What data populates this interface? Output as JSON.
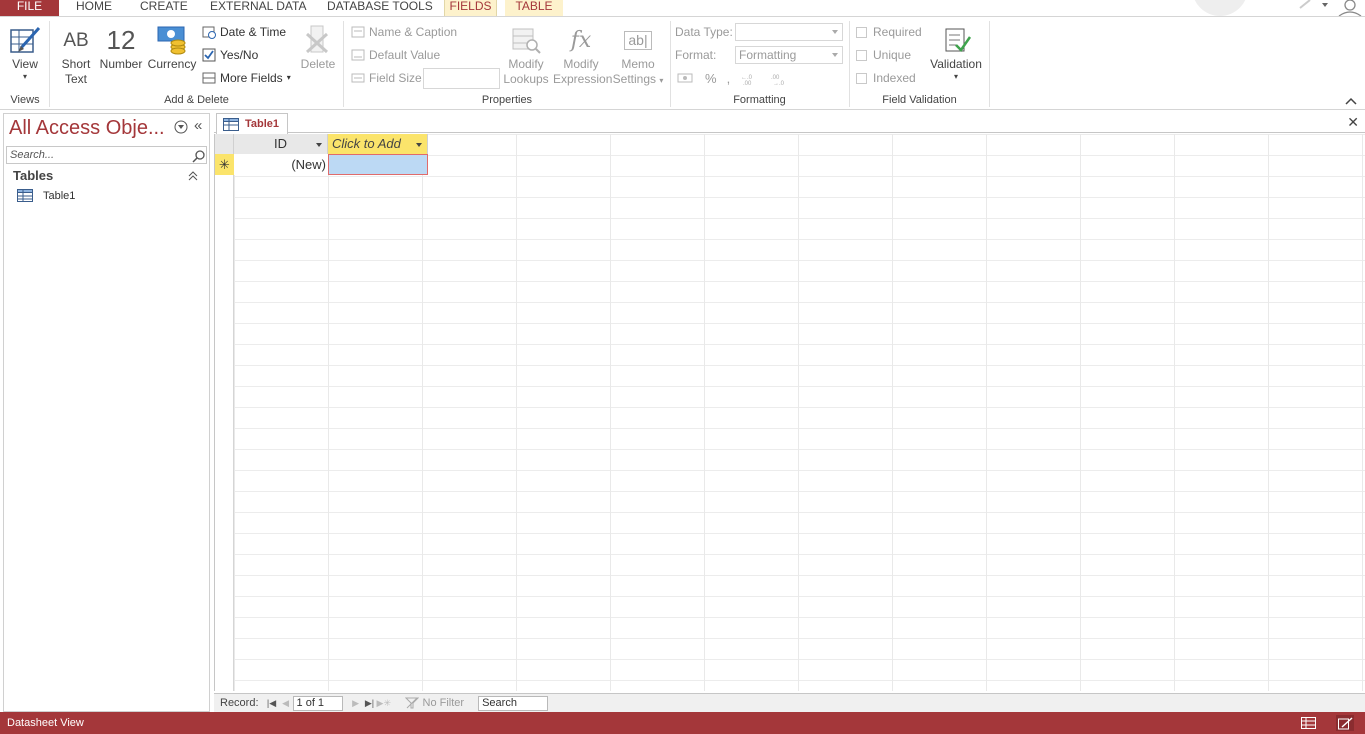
{
  "tabs": [
    {
      "label": "FILE"
    },
    {
      "label": "HOME"
    },
    {
      "label": "CREATE"
    },
    {
      "label": "EXTERNAL DATA"
    },
    {
      "label": "DATABASE TOOLS"
    },
    {
      "label": "FIELDS"
    },
    {
      "label": "TABLE"
    }
  ],
  "ribbon": {
    "views": {
      "view_label": "View",
      "group": "Views"
    },
    "add_delete": {
      "short_text": "Short Text",
      "number_glyph": "12",
      "number": "Number",
      "currency": "Currency",
      "date_time": "Date & Time",
      "yes_no": "Yes/No",
      "more_fields": "More Fields",
      "delete": "Delete",
      "group": "Add & Delete",
      "short_text_glyph": "AB"
    },
    "properties": {
      "name_caption": "Name & Caption",
      "default_value": "Default Value",
      "field_size": "Field Size",
      "modify_lookups_1": "Modify",
      "modify_lookups_2": "Lookups",
      "modify_expression_1": "Modify",
      "modify_expression_2": "Expression",
      "memo_settings_1": "Memo",
      "memo_settings_2": "Settings",
      "group": "Properties",
      "expression_glyph": "fx",
      "memo_glyph": "ab|"
    },
    "formatting": {
      "data_type_label": "Data Type:",
      "format_label": "Format:",
      "format_value": "Formatting",
      "group": "Formatting",
      "percent_glyph": "%",
      "comma_glyph": ","
    },
    "field_validation": {
      "required": "Required",
      "unique": "Unique",
      "indexed": "Indexed",
      "validation": "Validation",
      "group": "Field Validation"
    }
  },
  "nav_pane": {
    "title": "All Access Obje...",
    "search_placeholder": "Search...",
    "section": "Tables",
    "items": [
      {
        "label": "Table1"
      }
    ]
  },
  "document": {
    "tab_label": "Table1",
    "columns": [
      {
        "label": "ID"
      },
      {
        "label": "Click to Add"
      }
    ],
    "new_row_marker": "✳",
    "new_row_id": "(New)"
  },
  "record_nav": {
    "label": "Record:",
    "position": "1 of 1",
    "filter": "No Filter",
    "search": "Search"
  },
  "status": {
    "text": "Datasheet View"
  },
  "colors": {
    "accent": "#a4373a",
    "context_tab": "#fdf2cc",
    "header_highlight": "#fbe46b",
    "selection": "#bcd9f4"
  }
}
